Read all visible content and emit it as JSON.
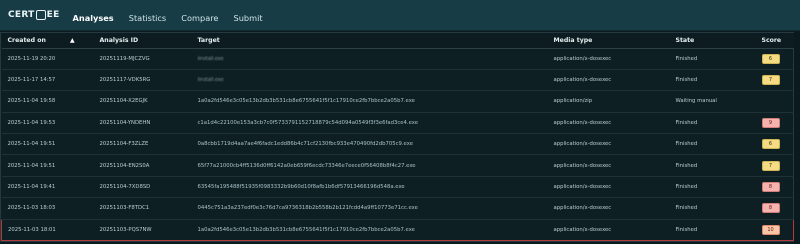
{
  "app": {
    "logo_text_left": "CERT",
    "logo_text_right": "EE",
    "nav": [
      {
        "label": "Analyses",
        "active": true
      },
      {
        "label": "Statistics",
        "active": false
      },
      {
        "label": "Compare",
        "active": false
      },
      {
        "label": "Submit",
        "active": false
      }
    ]
  },
  "table": {
    "headers": {
      "created_on": "Created on",
      "sort_indicator": "▲",
      "analysis_id": "Analysis ID",
      "target": "Target",
      "media_type": "Media type",
      "state": "State",
      "score": "Score"
    },
    "rows": [
      {
        "created_on": "2025-11-19 20:20",
        "analysis_id": "20251119-MJCZVG",
        "target": "iinstall.exe",
        "media_type": "application/x-dosexec",
        "state": "Finished",
        "score": "6",
        "badge": "yellow"
      },
      {
        "created_on": "2025-11-17 14:57",
        "analysis_id": "20251117-VDK5RG",
        "target": "iinstall.exe",
        "media_type": "application/x-dosexec",
        "state": "Finished",
        "score": "7",
        "badge": "yellow"
      },
      {
        "created_on": "2025-11-04 19:58",
        "analysis_id": "20251104-X2EGJK",
        "target": "1a0a2fd546e3c05e13b2db3b531cb8e6755641f5f1c17910ce2fb7bbce2a05b7.exe",
        "media_type": "application/zip",
        "state": "Waiting manual",
        "score": "",
        "badge": ""
      },
      {
        "created_on": "2025-11-04 19:53",
        "analysis_id": "20251104-YNDEHN",
        "target": "c1a1d4c22100e153a3cb7c0f5733791152718879c54d094a0549f3f3e6fad3ce4.exe",
        "media_type": "application/x-dosexec",
        "state": "Finished",
        "score": "9",
        "badge": "red"
      },
      {
        "created_on": "2025-11-04 19:51",
        "analysis_id": "20251104-F3ZLZE",
        "target": "0a8cbb1719d4aa7ae4f6fadc1edd86b4c71cf2130fbc933e470490fd2db705c9.exe",
        "media_type": "application/x-dosexec",
        "state": "Finished",
        "score": "6",
        "badge": "yellow"
      },
      {
        "created_on": "2025-11-04 19:51",
        "analysis_id": "20251104-EN2S0A",
        "target": "65f77a21000cb4ff5136d0ff6142a0eb659f6ecdc73346e7eece0f56408b8f4c27.exe",
        "media_type": "application/x-dosexec",
        "state": "Finished",
        "score": "7",
        "badge": "yellow"
      },
      {
        "created_on": "2025-11-04 19:41",
        "analysis_id": "20251104-7XD8SD",
        "target": "63545fa195488f51935f0983332b9b60d10f8afb1b6df57913466196d548a.exe",
        "media_type": "application/x-dosexec",
        "state": "Finished",
        "score": "8",
        "badge": "red"
      },
      {
        "created_on": "2025-11-03 18:03",
        "analysis_id": "20251103-F8TDC1",
        "target": "0445c751a3a237edf0e3c76d7ca9736318b2b558b2b121fcdd4a9ff10773e71cc.exe",
        "media_type": "application/x-dosexec",
        "state": "Finished",
        "score": "8",
        "badge": "red"
      },
      {
        "created_on": "2025-11-03 18:01",
        "analysis_id": "20251103-PQS7NW",
        "target": "1a0a2fd546e3c05e13b2db3b531cb8e6755641f5f1c17910ce2fb7bbce2a05b7.exe",
        "media_type": "application/x-dosexec",
        "state": "Finished",
        "score": "10",
        "badge": "red2",
        "highlight": true
      }
    ]
  }
}
